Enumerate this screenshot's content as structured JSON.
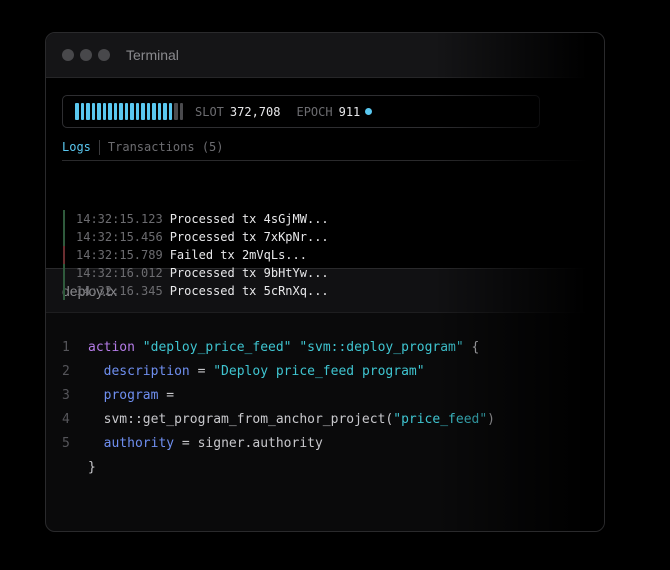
{
  "window": {
    "title": "Terminal"
  },
  "status": {
    "progress_fraction": 0.9,
    "bar_count": 20,
    "filled_bars": 18,
    "slot_label": "SLOT",
    "slot_value": "372,708",
    "epoch_label": "EPOCH",
    "epoch_value": "911"
  },
  "tabs": [
    {
      "label": "Logs",
      "active": true
    },
    {
      "label": "Transactions (5)",
      "active": false
    }
  ],
  "logs": [
    {
      "time": "14:32:15.123",
      "message": "Processed tx 4sGjMW...",
      "status": "success"
    },
    {
      "time": "14:32:15.456",
      "message": "Processed tx 7xKpNr...",
      "status": "success"
    },
    {
      "time": "14:32:15.789",
      "message": "Failed tx 2mVqLs...",
      "status": "failed"
    },
    {
      "time": "14:32:16.012",
      "message": "Processed tx 9bHtYw...",
      "status": "success"
    },
    {
      "time": "14:32:16.345",
      "message": "Processed tx 5cRnXq...",
      "status": "success"
    }
  ],
  "file": {
    "name": "deploy.tx",
    "lines": {
      "n1": "1",
      "n2": "2",
      "n3": "3",
      "n4": "4",
      "n5": "5",
      "l1_kw": "action",
      "l1_s1": "\"deploy_price_feed\"",
      "l1_s2": "\"svm::deploy_program\"",
      "l1_brace": "{",
      "l2_prop": "description",
      "l2_op": " = ",
      "l2_str": "\"Deploy price_feed program\"",
      "l3_prop": "program",
      "l3_op": " =",
      "l4_fn": "svm::get_program_from_anchor_project(",
      "l4_str": "\"price_feed\"",
      "l4_end": ")",
      "l5_prop": "authority",
      "l5_op": " = ",
      "l5_val": "signer.authority",
      "close": "}"
    }
  },
  "colors": {
    "accent": "#5ac8f0",
    "keyword": "#b57ce8",
    "string": "#3fc5d1",
    "property": "#6f8ff0"
  }
}
